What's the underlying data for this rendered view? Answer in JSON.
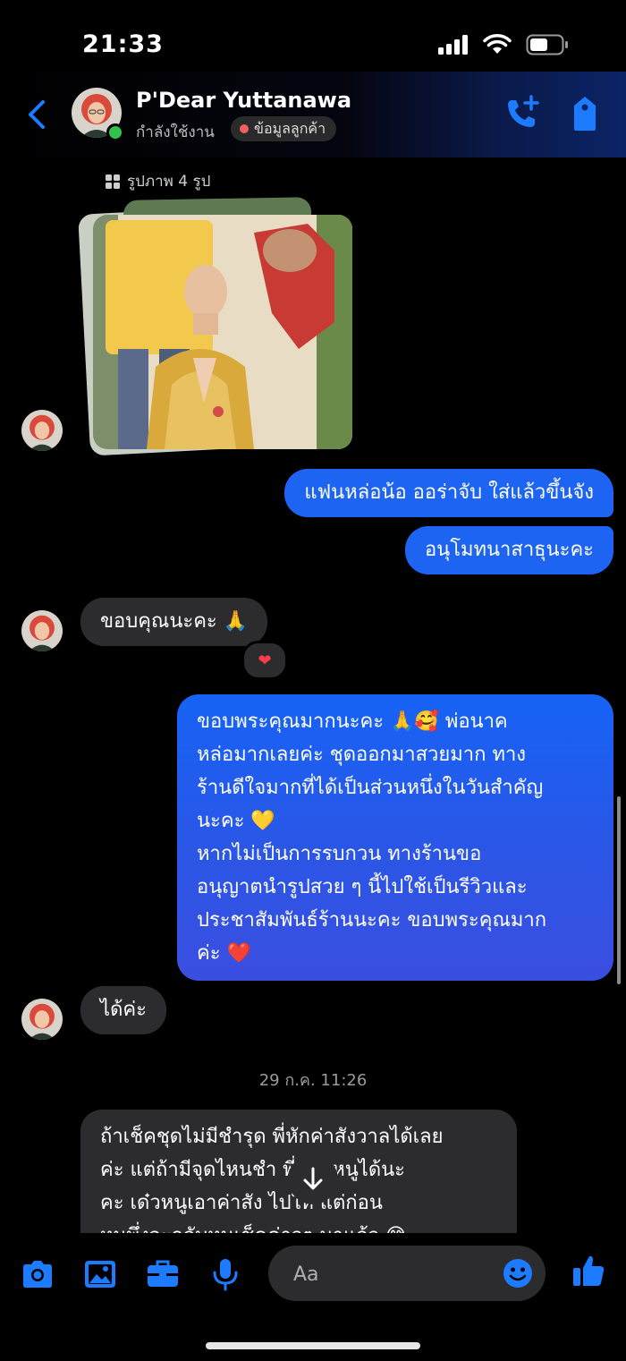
{
  "status_bar": {
    "time": "21:33"
  },
  "header": {
    "name": "P'Dear Yuttanawa",
    "status": "กำลังใช้งาน",
    "tag": "ข้อมูลลูกค้า"
  },
  "photos": {
    "caption": "รูปภาพ 4 รูป"
  },
  "messages": {
    "out_1": "แฟนหล่อน้อ ออร่าจับ ใส่แล้วขึ้นจัง",
    "out_2": "อนุโมทนาสาธุนะคะ",
    "in_1": "ขอบคุณนะคะ 🙏",
    "in_1_reaction": "❤",
    "out_3_lines": [
      "ขอบพระคุณมากนะคะ 🙏🥰 พ่อนาค",
      "หล่อมากเลยค่ะ ชุดออกมาสวยมาก ทาง",
      "ร้านดีใจมากที่ได้เป็นส่วนหนึ่งในวันสำคัญ",
      "นะคะ 💛",
      "หากไม่เป็นการรบกวน ทางร้านขอ",
      "อนุญาตนำรูปสวย ๆ นี้ไปใช้เป็นรีวิวและ",
      "ประชาสัมพันธ์ร้านนะคะ ขอบพระคุณมาก",
      "ค่ะ ❤️"
    ],
    "in_2": "ได้ค่ะ",
    "date_separator": "29 ก.ค. 11:26",
    "in_3_lines": [
      "ถ้าเช็คชุดไม่มีชำรุด พี่หักค่าสังวาลได้เลย",
      "ค่ะ แต่ถ้ามีจุดไหนชำ   พี่บอกหนูได้นะ",
      "คะ เด๋วหนูเอาค่าสัง    ไปให้ แต่ก่อน",
      "หนูพึ่งจะกลับหนูเช็คค่าวๆ มาแล้ว 😅"
    ]
  },
  "composer": {
    "placeholder": "Aa"
  },
  "colors": {
    "accent": "#1d64f2",
    "incoming_bubble": "#2c2c2e",
    "background": "#000000"
  }
}
